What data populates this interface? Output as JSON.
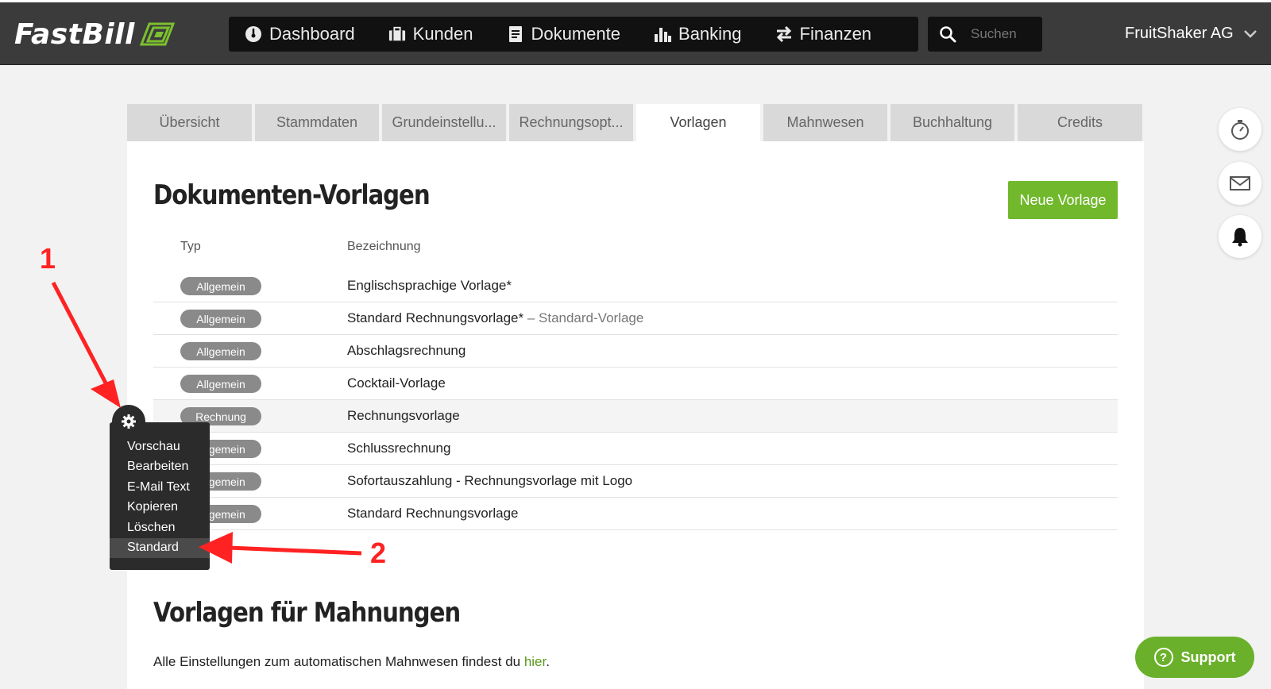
{
  "app": {
    "logo_text": "FastBill"
  },
  "nav": {
    "items": [
      {
        "label": "Dashboard",
        "icon": "speedometer-icon"
      },
      {
        "label": "Kunden",
        "icon": "briefcase-icon"
      },
      {
        "label": "Dokumente",
        "icon": "document-icon"
      },
      {
        "label": "Banking",
        "icon": "bar-chart-icon"
      },
      {
        "label": "Finanzen",
        "icon": "transfer-arrows-icon"
      }
    ],
    "search_placeholder": "Suchen",
    "company": "FruitShaker AG"
  },
  "tabs": [
    {
      "label": "Übersicht",
      "active": false
    },
    {
      "label": "Stammdaten",
      "active": false
    },
    {
      "label": "Grundeinstellu...",
      "active": false
    },
    {
      "label": "Rechnungsopt...",
      "active": false
    },
    {
      "label": "Vorlagen",
      "active": true
    },
    {
      "label": "Mahnwesen",
      "active": false
    },
    {
      "label": "Buchhaltung",
      "active": false
    },
    {
      "label": "Credits",
      "active": false
    }
  ],
  "main": {
    "title": "Dokumenten-Vorlagen",
    "new_button": "Neue Vorlage",
    "col_type": "Typ",
    "col_name": "Bezeichnung",
    "rows": [
      {
        "type": "Allgemein",
        "name": "Englischsprachige Vorlage*",
        "suffix": ""
      },
      {
        "type": "Allgemein",
        "name": "Standard Rechnungsvorlage*",
        "suffix": " – Standard-Vorlage"
      },
      {
        "type": "Allgemein",
        "name": "Abschlagsrechnung",
        "suffix": ""
      },
      {
        "type": "Allgemein",
        "name": "Cocktail-Vorlage",
        "suffix": ""
      },
      {
        "type": "Rechnung",
        "name": "Rechnungsvorlage",
        "suffix": ""
      },
      {
        "type": "Allgemein",
        "name": "Schlussrechnung",
        "suffix": ""
      },
      {
        "type": "Allgemein",
        "name": "Sofortauszahlung - Rechnungsvorlage mit Logo",
        "suffix": ""
      },
      {
        "type": "Allgemein",
        "name": "Standard Rechnungsvorlage",
        "suffix": ""
      }
    ],
    "section2_title": "Vorlagen für Mahnungen",
    "section2_text": "Alle Einstellungen zum automatischen Mahnwesen findest du ",
    "section2_link": "hier",
    "section2_end": "."
  },
  "context_menu": {
    "items": [
      "Vorschau",
      "Bearbeiten",
      "E-Mail Text",
      "Kopieren",
      "Löschen",
      "Standard"
    ],
    "selected": "Standard"
  },
  "side_buttons": [
    "stopwatch-icon",
    "mail-icon",
    "bell-icon"
  ],
  "support_label": "Support",
  "annotations": {
    "marker_1": "1",
    "marker_2": "2"
  },
  "colors": {
    "accent_green": "#71b82d",
    "topbar": "#3b3b3b",
    "annotation_red": "#f22"
  }
}
